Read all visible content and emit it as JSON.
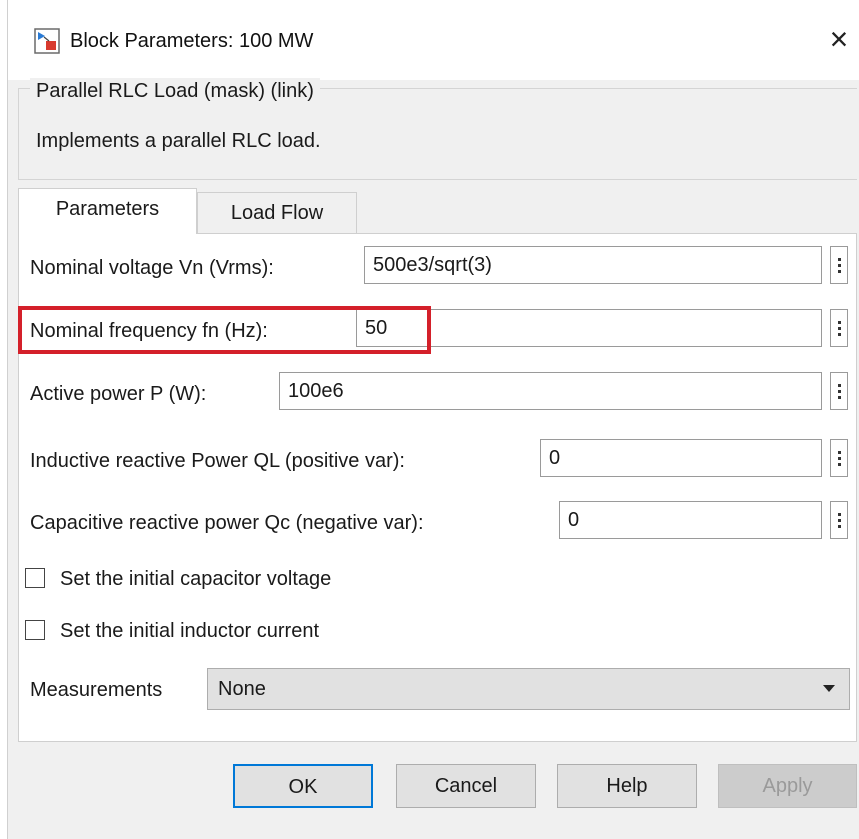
{
  "window": {
    "title": "Block Parameters: 100 MW",
    "close_label": "×",
    "app_icon": "simulink-block-icon"
  },
  "description": {
    "group_title": "Parallel RLC Load (mask) (link)",
    "text": "Implements a parallel RLC load."
  },
  "tabs": [
    {
      "label": "Parameters",
      "selected": true
    },
    {
      "label": "Load Flow",
      "selected": false
    }
  ],
  "params": {
    "vn": {
      "label": "Nominal voltage Vn (Vrms):",
      "value": "500e3/sqrt(3)"
    },
    "fn": {
      "label": "Nominal frequency fn (Hz):",
      "value": "50"
    },
    "p": {
      "label": "Active power P (W):",
      "value": "100e6"
    },
    "ql": {
      "label": "Inductive reactive Power QL (positive var):",
      "value": "0"
    },
    "qc": {
      "label": "Capacitive reactive power Qc (negative var):",
      "value": "0"
    }
  },
  "checkboxes": {
    "cap_voltage": {
      "label": "Set the initial capacitor voltage",
      "checked": false
    },
    "ind_current": {
      "label": "Set the initial inductor current",
      "checked": false
    }
  },
  "measurements": {
    "label": "Measurements",
    "selected": "None"
  },
  "buttons": {
    "ok": "OK",
    "cancel": "Cancel",
    "help": "Help",
    "apply": "Apply"
  },
  "colors": {
    "highlight": "#d4202a",
    "default_button_border": "#0078d7"
  }
}
